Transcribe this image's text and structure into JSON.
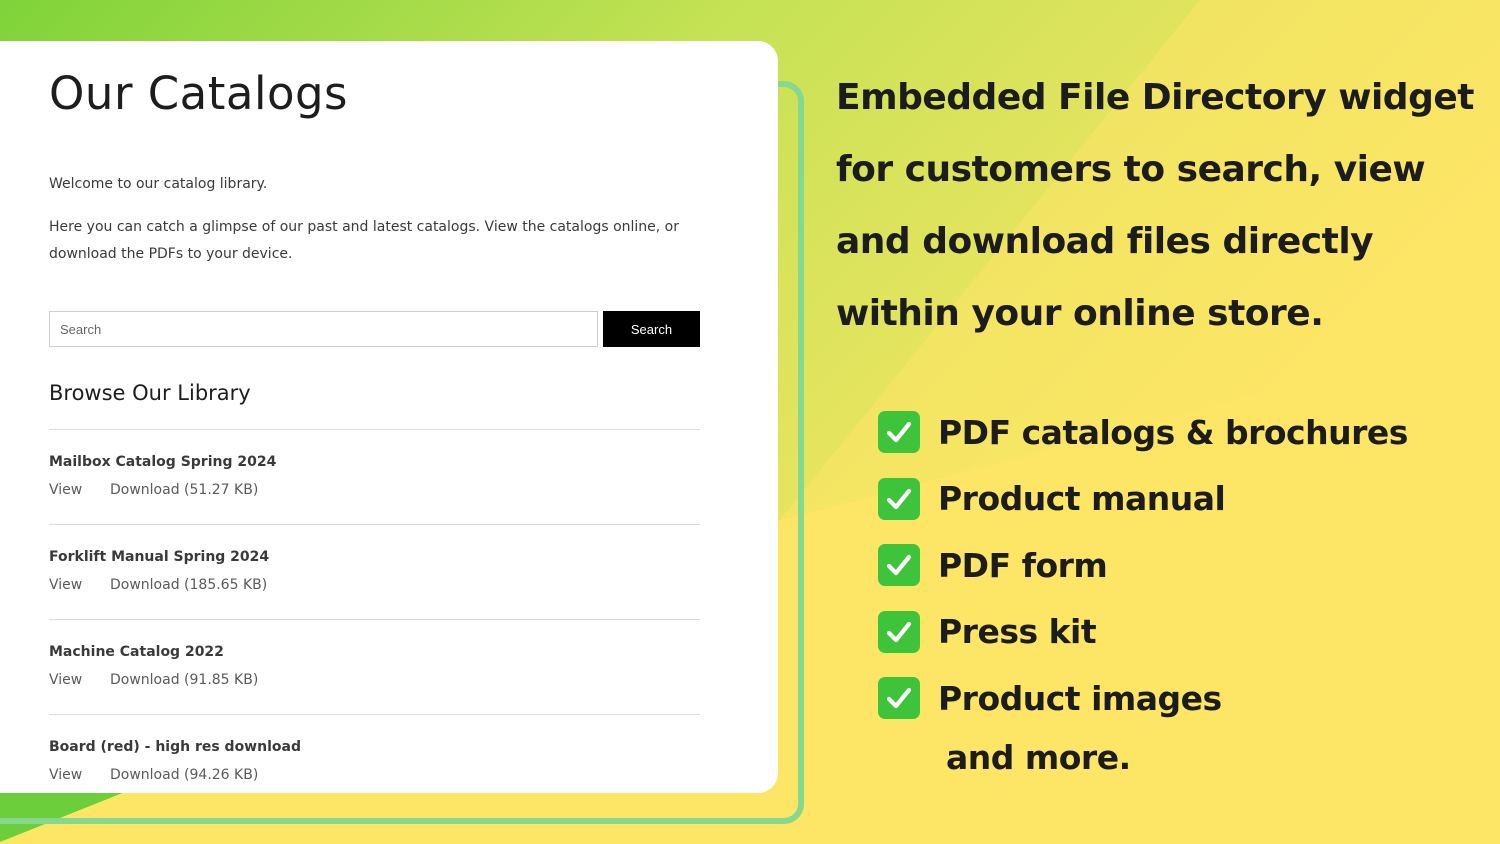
{
  "colors": {
    "background_yellow": "#fde566",
    "background_green": "#9fd94a",
    "accent_outline": "#86d88e",
    "check_green": "#3ec43a",
    "search_button": "#000000"
  },
  "catalog": {
    "title": "Our Catalogs",
    "intro_welcome": "Welcome to our catalog library.",
    "intro_details": "Here you can catch a glimpse of our past and latest catalogs. View the catalogs online, or download the PDFs to your device.",
    "search": {
      "placeholder": "Search",
      "button_label": "Search"
    },
    "browse_heading": "Browse Our Library",
    "files": [
      {
        "name": "Mailbox Catalog Spring 2024",
        "view_label": "View",
        "download_label": "Download (51.27 KB)"
      },
      {
        "name": "Forklift Manual Spring 2024",
        "view_label": "View",
        "download_label": "Download (185.65 KB)"
      },
      {
        "name": "Machine Catalog 2022",
        "view_label": "View",
        "download_label": "Download (91.85 KB)"
      },
      {
        "name": "Board (red) - high res download",
        "view_label": "View",
        "download_label": "Download (94.26 KB)"
      }
    ]
  },
  "promo": {
    "headline_lines": [
      "Embedded File Directory widget",
      "for customers to search, view",
      "and download files directly",
      "within your online store."
    ],
    "features": [
      {
        "icon": "check-mark-icon",
        "label": "PDF catalogs & brochures"
      },
      {
        "icon": "check-mark-icon",
        "label": "Product manual"
      },
      {
        "icon": "check-mark-icon",
        "label": "PDF form"
      },
      {
        "icon": "check-mark-icon",
        "label": "Press kit"
      },
      {
        "icon": "check-mark-icon",
        "label": "Product images"
      }
    ],
    "and_more": "and more."
  }
}
